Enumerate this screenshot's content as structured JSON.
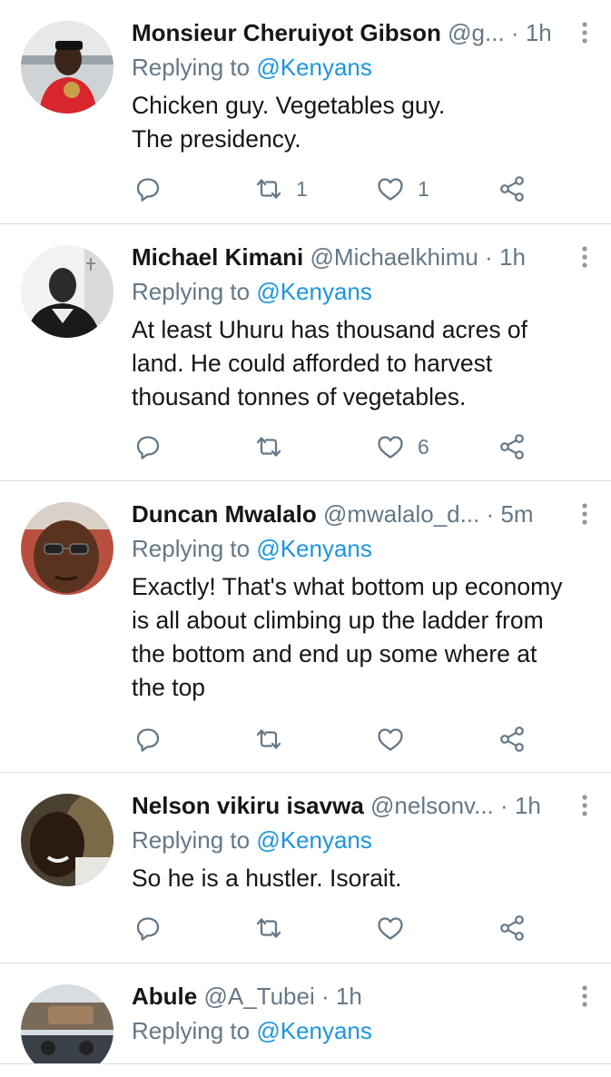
{
  "colors": {
    "name": "#14171a",
    "secondary": "#657786",
    "mention": "#1b95e0",
    "divider": "#d9dde0"
  },
  "tweets": [
    {
      "name": "Monsieur Cheruiyot Gibson",
      "handle": "@g...",
      "time": "1h",
      "replying_prefix": "Replying to",
      "replying_to": "@Kenyans",
      "lines": [
        "Chicken guy. Vegetables guy.",
        "The presidency."
      ],
      "retweets": "1",
      "likes": "1"
    },
    {
      "name": "Michael Kimani",
      "handle": "@Michaelkhimu",
      "time": "1h",
      "replying_prefix": "Replying to",
      "replying_to": "@Kenyans",
      "lines": [
        "At least Uhuru has thousand acres of",
        "land. He could afforded to harvest",
        "thousand tonnes of vegetables."
      ],
      "retweets": "",
      "likes": "6"
    },
    {
      "name": "Duncan Mwalalo",
      "handle": "@mwalalo_d...",
      "time": "5m",
      "replying_prefix": "Replying to",
      "replying_to": "@Kenyans",
      "lines": [
        "Exactly! That's what bottom up economy",
        "is all about climbing up the ladder from",
        "the bottom and end up some where at",
        "the top"
      ],
      "retweets": "",
      "likes": ""
    },
    {
      "name": "Nelson vikiru isavwa",
      "handle": "@nelsonv...",
      "time": "1h",
      "replying_prefix": "Replying to",
      "replying_to": "@Kenyans",
      "lines": [
        "So he is a hustler. Isorait."
      ],
      "retweets": "",
      "likes": ""
    },
    {
      "name": "Abule",
      "handle": "@A_Tubei",
      "time": "1h",
      "replying_prefix": "Replying to",
      "replying_to": "@Kenyans",
      "lines": [],
      "retweets": "",
      "likes": ""
    }
  ]
}
